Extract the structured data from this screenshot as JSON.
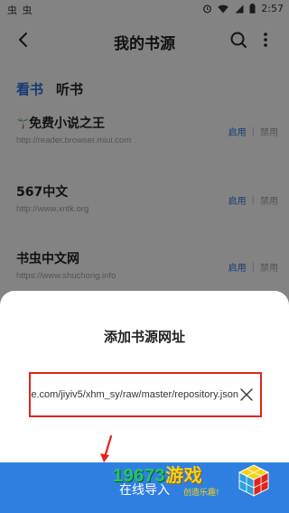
{
  "statusbar": {
    "left_icons": "虫 虫",
    "time": "2:57"
  },
  "appbar": {
    "title": "我的书源"
  },
  "tabs": [
    {
      "label": "看书",
      "active": true
    },
    {
      "label": "听书",
      "active": false
    }
  ],
  "sources": [
    {
      "name": "免费小说之王",
      "url": "http://reader.browser.miui.com",
      "enable_label": "启用",
      "separator": "|",
      "disable_label": "禁用"
    },
    {
      "name": "567中文",
      "url": "http://www.xntk.org",
      "enable_label": "启用",
      "separator": "|",
      "disable_label": "禁用"
    },
    {
      "name": "书虫中文网",
      "url": "https://www.shuchong.info",
      "enable_label": "启用",
      "separator": "|",
      "disable_label": "禁用"
    }
  ],
  "dialog": {
    "title": "添加书源网址",
    "input_value": "e.com/jiyiv5/xhm_sy/raw/master/repository.json",
    "import_button": "在线导入"
  },
  "watermark": {
    "brand_number": "19673",
    "brand_cn": "游戏",
    "slogan": "创造乐趣!"
  },
  "colors": {
    "accent": "#2a6cd6",
    "import_bar": "#2f7fe0",
    "highlight_border": "#e2231a"
  }
}
